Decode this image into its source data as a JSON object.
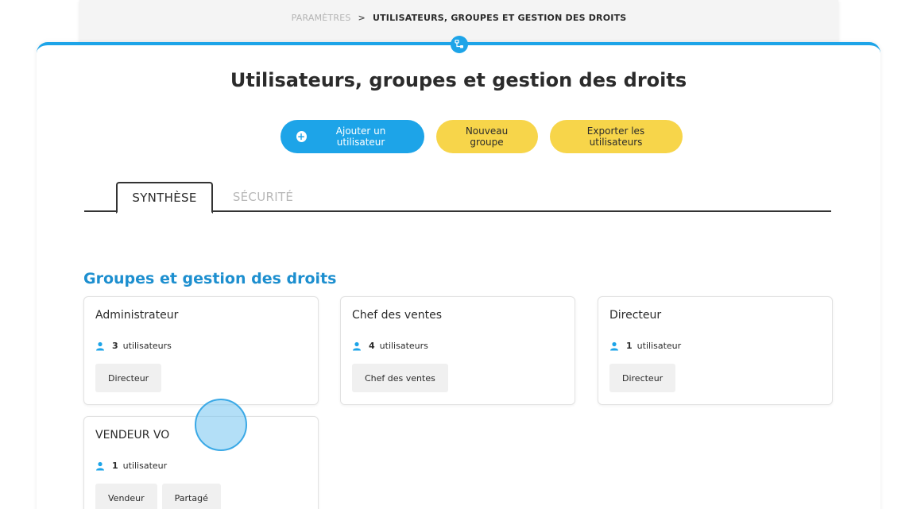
{
  "breadcrumb": {
    "parent": "PARAMÈTRES",
    "separator": ">",
    "current": "UTILISATEURS, GROUPES ET GESTION DES DROITS"
  },
  "page": {
    "title": "Utilisateurs, groupes et gestion des droits",
    "badge_icon": "org-chart-icon"
  },
  "actions": {
    "add_user": "Ajouter un utilisateur",
    "new_group": "Nouveau groupe",
    "export_users": "Exporter les utilisateurs"
  },
  "tabs": [
    {
      "label": "SYNTHÈSE",
      "active": true
    },
    {
      "label": "SÉCURITÉ",
      "active": false
    }
  ],
  "section": {
    "title": "Groupes et gestion des droits"
  },
  "groups": [
    {
      "name": "Administrateur",
      "count": "3",
      "unit": "utilisateurs",
      "tags": [
        "Directeur"
      ]
    },
    {
      "name": "Chef des ventes",
      "count": "4",
      "unit": "utilisateurs",
      "tags": [
        "Chef des ventes"
      ]
    },
    {
      "name": "Directeur",
      "count": "1",
      "unit": "utilisateur",
      "tags": [
        "Directeur"
      ]
    },
    {
      "name": "VENDEUR VO",
      "count": "1",
      "unit": "utilisateur",
      "tags": [
        "Vendeur",
        "Partagé"
      ]
    }
  ],
  "colors": {
    "accent": "#1da4e8",
    "section_title": "#1d8fcf",
    "secondary_button": "#f7d54a",
    "tag_background": "#f0f0f0"
  }
}
